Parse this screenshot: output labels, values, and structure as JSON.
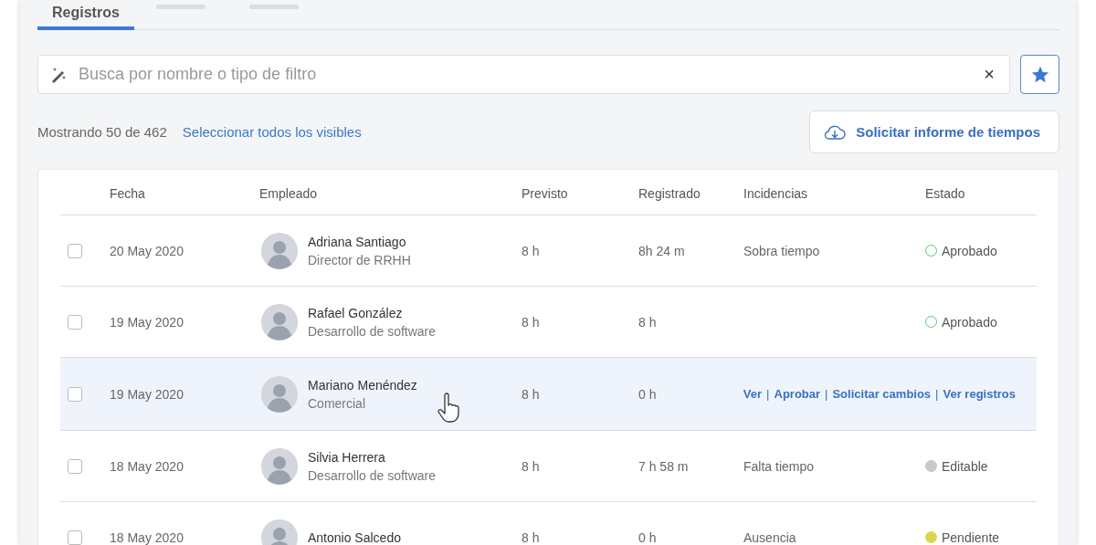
{
  "tabs": [
    {
      "label": "Registros",
      "selected": true
    },
    {
      "selected": false
    },
    {
      "selected": false
    }
  ],
  "search": {
    "placeholder": "Busca por nombre o tipo de filtro",
    "clear": "×"
  },
  "summary": {
    "count": "Mostrando 50 de 462",
    "select_all": "Seleccionar todos los visibles"
  },
  "report_button": "Solicitar informe de tiempos",
  "table": {
    "columns": [
      "Fecha",
      "Empleado",
      "Previsto",
      "Registrado",
      "Incidencias",
      "Estado"
    ],
    "rows": [
      {
        "checked": false,
        "hovered": false,
        "date": "20 May 2020",
        "name": "Adriana Santiago",
        "role": "Director de RRHH",
        "planned": "8 h",
        "logged": "8h 24 m",
        "incident": "Sobra tiempo",
        "status": {
          "label": "Aprobado",
          "color": "#5cc46b",
          "kind": "outline"
        }
      },
      {
        "checked": false,
        "hovered": false,
        "date": "19 May 2020",
        "name": "Rafael González",
        "role": "Desarrollo de software",
        "planned": "8 h",
        "logged": "8 h",
        "status": {
          "label": "Aprobado",
          "color": "#5cc46b",
          "kind": "outline"
        }
      },
      {
        "checked": false,
        "hovered": true,
        "date": "19 May 2020",
        "name": "Mariano Menéndez",
        "role": "Comercial",
        "planned": "8 h",
        "logged": "0 h",
        "actions": [
          "Ver",
          "Aprobar",
          "Solicitar cambios",
          "Ver registros"
        ],
        "action_separator": "|"
      },
      {
        "checked": false,
        "hovered": false,
        "date": "18 May 2020",
        "name": "Silvia Herrera",
        "role": "Desarrollo de software",
        "planned": "8 h",
        "logged": "7 h 58 m",
        "incident": "Falta tiempo",
        "status": {
          "label": "Editable",
          "color": "#c8c8c8",
          "kind": "filled"
        }
      },
      {
        "checked": false,
        "hovered": false,
        "date": "18 May 2020",
        "name": "Antonio Salcedo",
        "planned": "8 h",
        "logged": "0 h",
        "incident": "Ausencia",
        "status": {
          "label": "Pendiente",
          "color": "#d9d84a",
          "kind": "filled"
        }
      }
    ]
  }
}
